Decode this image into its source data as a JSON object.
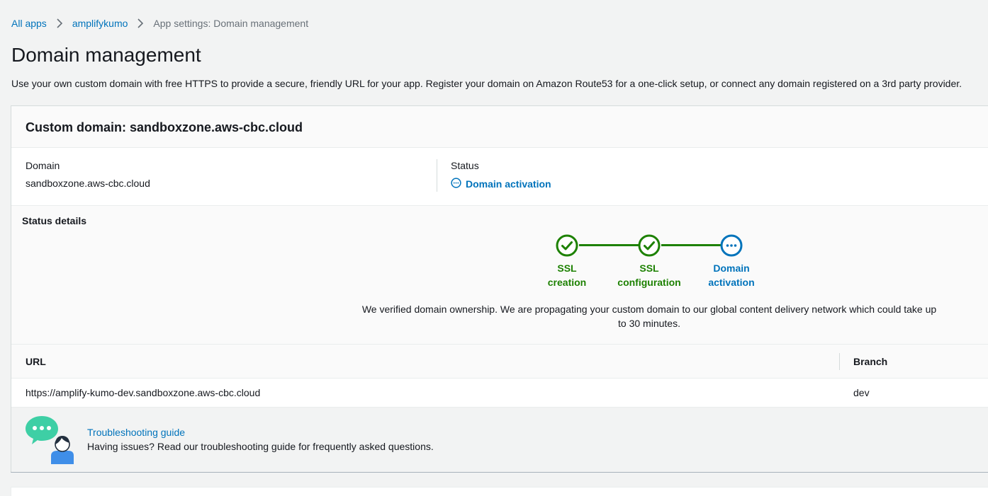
{
  "breadcrumb": {
    "items": [
      {
        "label": "All apps"
      },
      {
        "label": "amplifykumo"
      },
      {
        "label": "App settings: Domain management"
      }
    ]
  },
  "page": {
    "title": "Domain management",
    "description": "Use your own custom domain with free HTTPS to provide a secure, friendly URL for your app. Register your domain on Amazon Route53 for a one-click setup, or connect any domain registered on a 3rd party provider."
  },
  "custom_domain": {
    "title": "Custom domain: sandboxzone.aws-cbc.cloud",
    "domain_label": "Domain",
    "domain_value": "sandboxzone.aws-cbc.cloud",
    "status_label": "Status",
    "status_value": "Domain activation",
    "status_details_title": "Status details",
    "steps": [
      {
        "line1": "SSL",
        "line2": "creation",
        "state": "done"
      },
      {
        "line1": "SSL",
        "line2": "configuration",
        "state": "done"
      },
      {
        "line1": "Domain",
        "line2": "activation",
        "state": "in-progress"
      }
    ],
    "status_message": "We verified domain ownership. We are propagating your custom domain to our global content delivery network which could take up to 30 minutes.",
    "table": {
      "headers": {
        "url": "URL",
        "branch": "Branch"
      },
      "rows": [
        {
          "url": "https://amplify-kumo-dev.sandboxzone.aws-cbc.cloud",
          "branch": "dev"
        }
      ]
    }
  },
  "troubleshooting": {
    "link": "Troubleshooting guide",
    "text": "Having issues? Read our troubleshooting guide for frequently asked questions."
  },
  "colors": {
    "link": "#0073bb",
    "success": "#1d8102",
    "chat_bubble": "#3ecfa5"
  }
}
